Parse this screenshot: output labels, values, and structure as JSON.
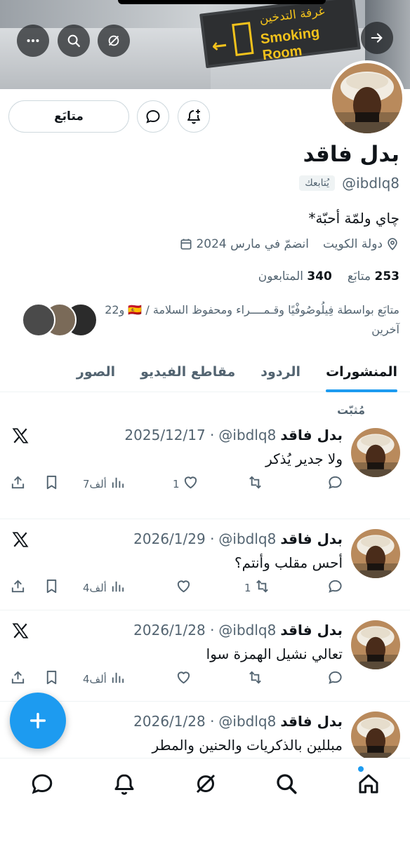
{
  "banner": {
    "sign_arabic": "غرفة التدخين",
    "sign_english": "Smoking Room"
  },
  "header_buttons": [
    "more-icon",
    "search-icon",
    "grok-icon",
    "back-arrow-icon"
  ],
  "profile": {
    "name": "بدل فاقد",
    "handle": "@ibdlq8",
    "follows_you": "يُتابعك",
    "bio": "چاي ولمّة أحبّة*",
    "location": "دولة الكويت",
    "joined": "انضمّ في مارس 2024",
    "following_count": "253",
    "following_label": "متابَع",
    "followers_count": "340",
    "followers_label": "المتابعون",
    "followed_by": "متابَع بواسطة فِيلُوصُوفْيًا وقـمــــراء ومحفوظ السلامة / 🇪🇸 و22 آخرين",
    "follow_button": "متابَع"
  },
  "tabs": [
    {
      "label": "المنشورات",
      "active": true
    },
    {
      "label": "الردود",
      "active": false
    },
    {
      "label": "مقاطع الفيديو",
      "active": false
    },
    {
      "label": "الصور",
      "active": false
    }
  ],
  "pinned_label": "مُثبّت",
  "posts": [
    {
      "name": "بدل فاقد",
      "handle": "@ibdlq8",
      "date": "2025/12/17 ·",
      "text": "ولا جدير يُذكر",
      "replies": "",
      "reposts": "",
      "likes": "1",
      "views": "7ألف"
    },
    {
      "name": "بدل فاقد",
      "handle": "@ibdlq8",
      "date": "2026/1/29 ·",
      "text": "أحس مقلب وأنتم؟",
      "replies": "",
      "reposts": "1",
      "likes": "",
      "views": "4ألف"
    },
    {
      "name": "بدل فاقد",
      "handle": "@ibdlq8",
      "date": "2026/1/28 ·",
      "text": "تعالي نشيل الهمزة سوا",
      "replies": "",
      "reposts": "",
      "likes": "",
      "views": "4ألف"
    },
    {
      "name": "بدل فاقد",
      "handle": "@ibdlq8",
      "date": "2026/1/28 ·",
      "text": "مبللين بالذكريات والحنين والمطر",
      "replies": "",
      "reposts": "",
      "likes": "",
      "views": ""
    }
  ],
  "colors": {
    "accent": "#1d9bf0",
    "text": "#0f1419",
    "muted": "#536471"
  }
}
